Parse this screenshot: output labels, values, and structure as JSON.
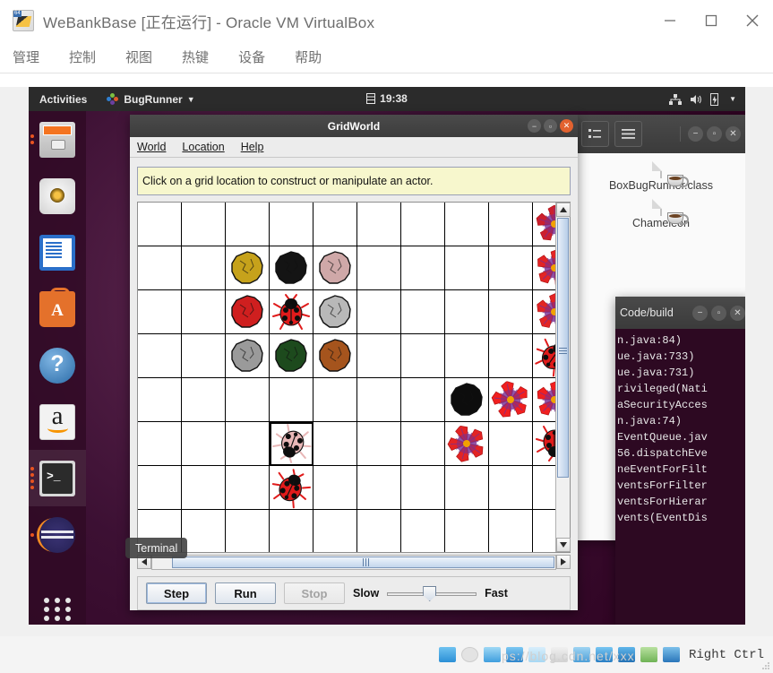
{
  "vbox": {
    "title": "WeBankBase [正在运行] - Oracle VM VirtualBox",
    "app_icon": "virtualbox-icon",
    "menus": [
      "管理",
      "控制",
      "视图",
      "热键",
      "设备",
      "帮助"
    ],
    "window_buttons": [
      "minimize-button",
      "maximize-button",
      "close-button"
    ],
    "status": {
      "host_key": "Right Ctrl",
      "watermark": "ps://blog.cdn.net/xxx",
      "icons": [
        "hard-disk-icon",
        "optical-disk-icon",
        "floppy-icon",
        "network-icon",
        "usb-icon",
        "shared-folder-icon",
        "display-icon",
        "recording-icon",
        "vm-cpu-icon",
        "mouse-integration-icon",
        "keyboard-icon"
      ]
    }
  },
  "gnome": {
    "activities": "Activities",
    "app_menu": "BugRunner",
    "clock": "19:38",
    "calendar_icon": "calendar-icon",
    "sys_icons": [
      "network-icon",
      "volume-icon",
      "battery-icon",
      "chevron-down-icon"
    ]
  },
  "dock": {
    "items": [
      {
        "name": "files",
        "label": "Files",
        "icon": "files-icon",
        "running": false,
        "active": false
      },
      {
        "name": "rhythmbox",
        "label": "Rhythmbox",
        "icon": "music-icon",
        "running": false,
        "active": false
      },
      {
        "name": "writer",
        "label": "LibreOffice Writer",
        "icon": "writer-icon",
        "running": false,
        "active": false
      },
      {
        "name": "software",
        "label": "Ubuntu Software",
        "icon": "software-icon",
        "running": false,
        "active": false
      },
      {
        "name": "help",
        "label": "Help",
        "icon": "help-icon",
        "running": false,
        "active": false
      },
      {
        "name": "amazon",
        "label": "Amazon",
        "icon": "amazon-icon",
        "running": false,
        "active": false
      },
      {
        "name": "terminal",
        "label": "Terminal",
        "icon": "terminal-icon",
        "running": true,
        "active": true
      },
      {
        "name": "eclipse",
        "label": "Eclipse",
        "icon": "eclipse-icon",
        "running": true,
        "active": false
      },
      {
        "name": "show-apps",
        "label": "Show Applications",
        "icon": "apps-grid-icon",
        "running": false,
        "active": false
      }
    ],
    "tooltip": "Terminal"
  },
  "gridworld": {
    "title": "GridWorld",
    "menus": [
      {
        "label": "World",
        "mnemonic": "W"
      },
      {
        "label": "Location",
        "mnemonic": "L"
      },
      {
        "label": "Help",
        "mnemonic": "H"
      }
    ],
    "hint": "Click on a grid location to construct or manipulate an actor.",
    "window_buttons": [
      "minimize-button",
      "maximize-button",
      "close-button"
    ],
    "controls": {
      "step": "Step",
      "run": "Run",
      "stop": "Stop",
      "stop_disabled": true,
      "slow_label": "Slow",
      "fast_label": "Fast",
      "speed_percent": 47
    },
    "grid": {
      "cols": 10,
      "rows": 8,
      "cell_size": 49,
      "selected": {
        "row": 5,
        "col": 3
      },
      "actors": [
        {
          "row": 0,
          "col": 9,
          "kind": "flower",
          "color": "#cc1f2e",
          "center": "#f2a100",
          "vein": "#7a2f8f",
          "rot": 0
        },
        {
          "row": 1,
          "col": 2,
          "kind": "rock",
          "color": "#c6a21b"
        },
        {
          "row": 1,
          "col": 3,
          "kind": "rock",
          "color": "#141414"
        },
        {
          "row": 1,
          "col": 4,
          "kind": "rock",
          "color": "#cfa8a8"
        },
        {
          "row": 1,
          "col": 9,
          "kind": "flower",
          "color": "#e32424",
          "center": "#f2a100",
          "vein": "#7a2f8f",
          "rot": 10
        },
        {
          "row": 2,
          "col": 2,
          "kind": "rock",
          "color": "#cf1f1f"
        },
        {
          "row": 2,
          "col": 3,
          "kind": "bug",
          "color": "#e01b1b",
          "rot": 0
        },
        {
          "row": 2,
          "col": 4,
          "kind": "rock",
          "color": "#b8b8b8"
        },
        {
          "row": 2,
          "col": 9,
          "kind": "flower",
          "color": "#e32424",
          "center": "#f2a100",
          "vein": "#7a2f8f",
          "rot": 5
        },
        {
          "row": 3,
          "col": 2,
          "kind": "rock",
          "color": "#9a9a9a"
        },
        {
          "row": 3,
          "col": 3,
          "kind": "rock",
          "color": "#1d4a1d"
        },
        {
          "row": 3,
          "col": 4,
          "kind": "rock",
          "color": "#a5541d"
        },
        {
          "row": 3,
          "col": 9,
          "kind": "bug",
          "color": "#e01b1b",
          "rot": 35
        },
        {
          "row": 4,
          "col": 7,
          "kind": "rock",
          "color": "#0d0d0d"
        },
        {
          "row": 4,
          "col": 8,
          "kind": "flower",
          "color": "#f11f1f",
          "center": "#f2a100",
          "vein": "#7a2f8f",
          "rot": -12
        },
        {
          "row": 4,
          "col": 9,
          "kind": "flower",
          "color": "#f11f1f",
          "center": "#f2a100",
          "vein": "#7a2f8f",
          "rot": 8
        },
        {
          "row": 5,
          "col": 3,
          "kind": "bug",
          "color": "#e8b7b7",
          "rot": 200
        },
        {
          "row": 5,
          "col": 7,
          "kind": "flower",
          "color": "#e32424",
          "center": "#f2a100",
          "vein": "#7a2f8f",
          "rot": -20
        },
        {
          "row": 5,
          "col": 9,
          "kind": "bug",
          "color": "#e01b1b",
          "rot": 180
        },
        {
          "row": 6,
          "col": 3,
          "kind": "bug",
          "color": "#e01b1b",
          "rot": 25
        }
      ]
    }
  },
  "nautilus": {
    "toolbar_icons": [
      "list-view-icon",
      "hamburger-menu-icon"
    ],
    "window_buttons": [
      "minimize-button",
      "maximize-button",
      "close-button"
    ],
    "files": [
      {
        "name": "BoxBugRunner.class",
        "icon": "java-class-icon"
      },
      {
        "name": "Chameleon",
        "icon": "java-class-icon"
      }
    ]
  },
  "terminal": {
    "title": "Code/build",
    "window_buttons": [
      "minimize-button",
      "maximize-button",
      "close-button"
    ],
    "lines": [
      "n.java:84)",
      "ue.java:733)",
      "ue.java:731)",
      "rivileged(Nati",
      "",
      "aSecurityAcces",
      "n.java:74)",
      "EventQueue.jav",
      "",
      "56.dispatchEve",
      "",
      "neEventForFilt",
      "",
      "ventsForFilter",
      "",
      "ventsForHierar",
      "",
      "vents(EventDis"
    ]
  }
}
